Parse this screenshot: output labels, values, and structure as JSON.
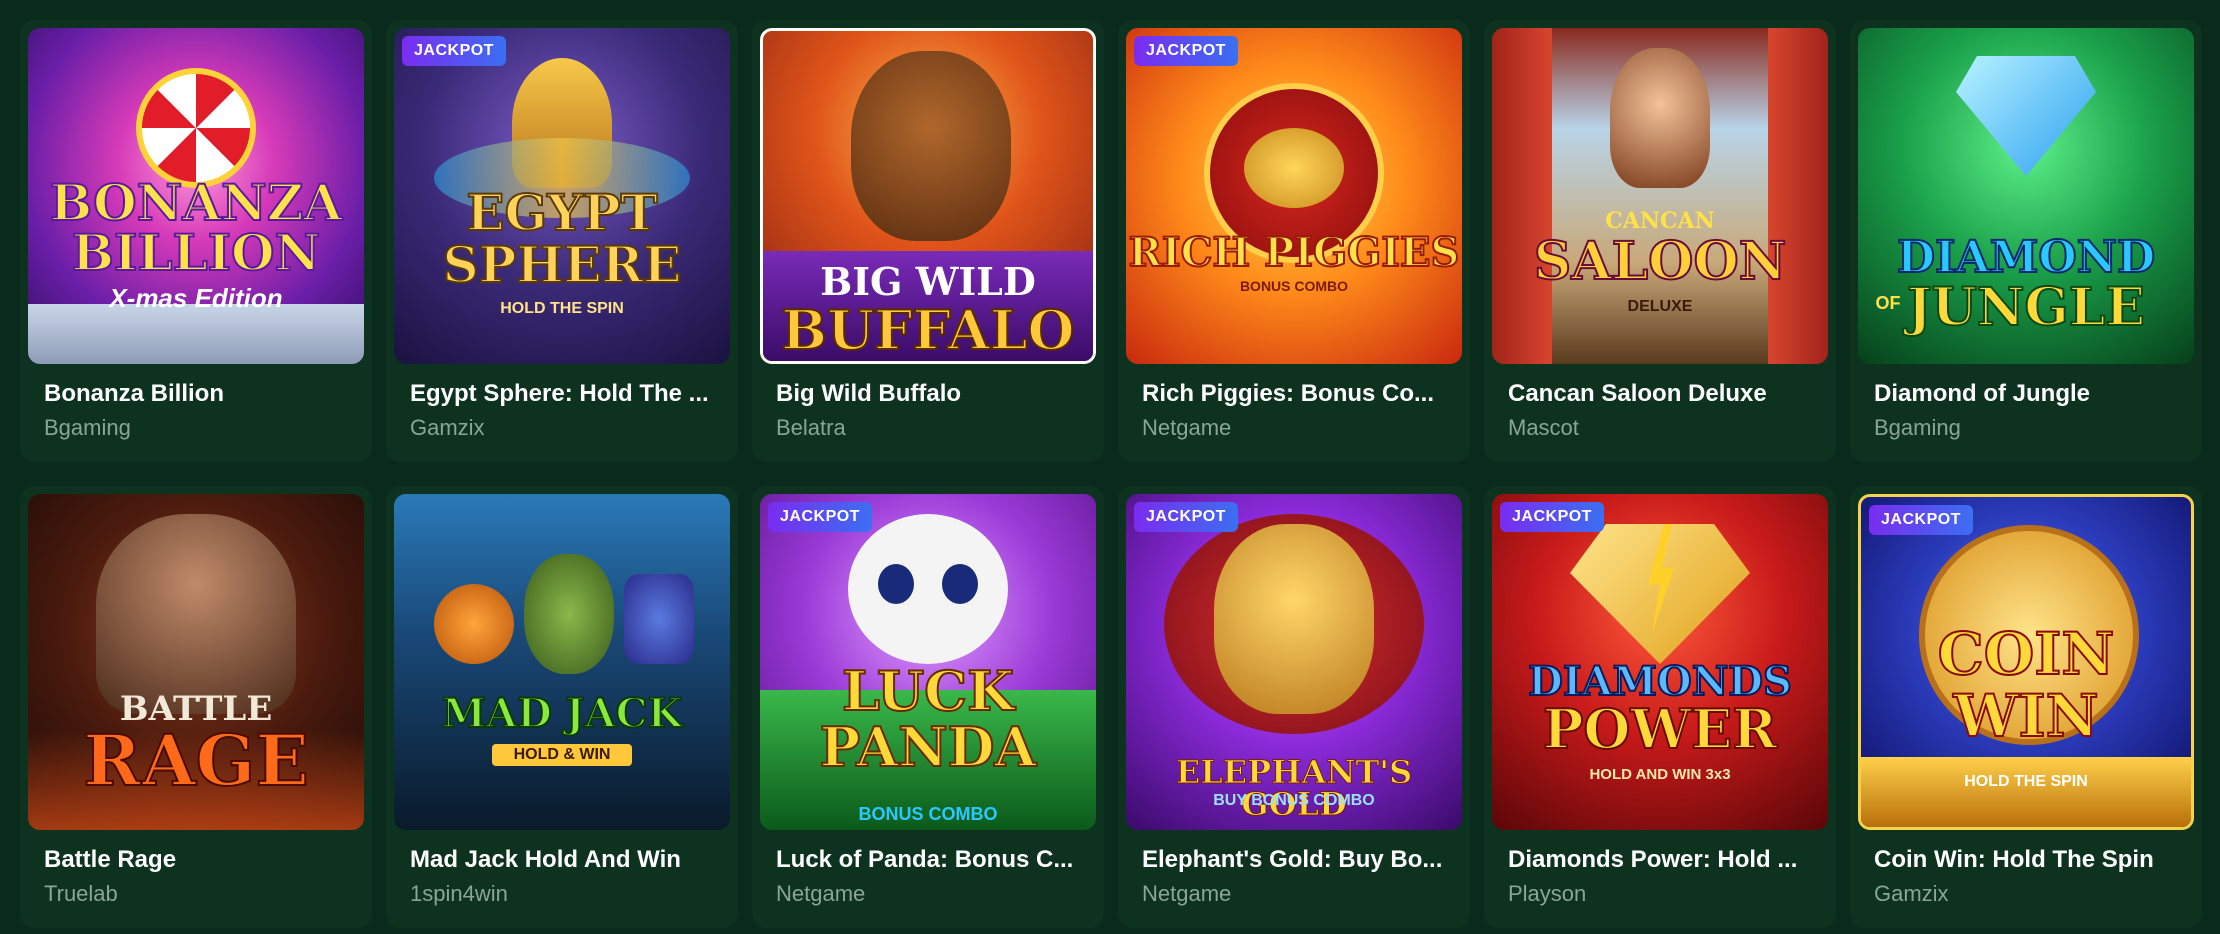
{
  "games": [
    {
      "name": "Bonanza Billion",
      "provider": "Bgaming",
      "jackpot": false,
      "art_lines": [
        "BONANZA",
        "BILLION"
      ],
      "art_sub": "X-mas Edition"
    },
    {
      "name": "Egypt Sphere: Hold The ...",
      "provider": "Gamzix",
      "jackpot": true,
      "art_lines": [
        "EGYPT",
        "SPHERE"
      ],
      "art_sub": "HOLD THE SPIN"
    },
    {
      "name": "Big Wild Buffalo",
      "provider": "Belatra",
      "jackpot": false,
      "art_lines": [
        "BIG WILD",
        "BUFFALO"
      ],
      "art_sub": ""
    },
    {
      "name": "Rich Piggies: Bonus Co...",
      "provider": "Netgame",
      "jackpot": true,
      "art_lines": [
        "RICH PIGGIES"
      ],
      "art_sub": "BONUS COMBO"
    },
    {
      "name": "Cancan Saloon Deluxe",
      "provider": "Mascot",
      "jackpot": false,
      "art_lines": [
        "CANCAN",
        "SALOON"
      ],
      "art_sub": "DELUXE"
    },
    {
      "name": "Diamond of Jungle",
      "provider": "Bgaming",
      "jackpot": false,
      "art_lines": [
        "DIAMOND",
        "JUNGLE"
      ],
      "art_sub": "OF"
    },
    {
      "name": "Battle Rage",
      "provider": "Truelab",
      "jackpot": false,
      "art_lines": [
        "BATTLE",
        "RAGE"
      ],
      "art_sub": ""
    },
    {
      "name": "Mad Jack Hold And Win",
      "provider": "1spin4win",
      "jackpot": false,
      "art_lines": [
        "MAD JACK"
      ],
      "art_sub": "HOLD & WIN"
    },
    {
      "name": "Luck of Panda: Bonus C...",
      "provider": "Netgame",
      "jackpot": true,
      "art_lines": [
        "LUCK",
        "PANDA"
      ],
      "art_sub": "BONUS COMBO"
    },
    {
      "name": "Elephant's Gold: Buy Bo...",
      "provider": "Netgame",
      "jackpot": true,
      "art_lines": [
        "ELEPHANT'S GOLD"
      ],
      "art_sub": "BUY BONUS COMBO"
    },
    {
      "name": "Diamonds Power: Hold ...",
      "provider": "Playson",
      "jackpot": true,
      "art_lines": [
        "DIAMONDS",
        "POWER"
      ],
      "art_sub": "HOLD AND WIN 3x3"
    },
    {
      "name": "Coin Win: Hold The Spin",
      "provider": "Gamzix",
      "jackpot": true,
      "art_lines": [
        "COIN",
        "WIN"
      ],
      "art_sub": "HOLD THE SPIN"
    }
  ],
  "badge_label": "JACKPOT",
  "colors": {
    "page_bg": "#0a2a1c",
    "card_bg": "#0e3220",
    "name_text": "#ffffff",
    "provider_text": "#8aa595",
    "badge_gradient_start": "#7a2cf0",
    "badge_gradient_end": "#3b6ff2"
  }
}
